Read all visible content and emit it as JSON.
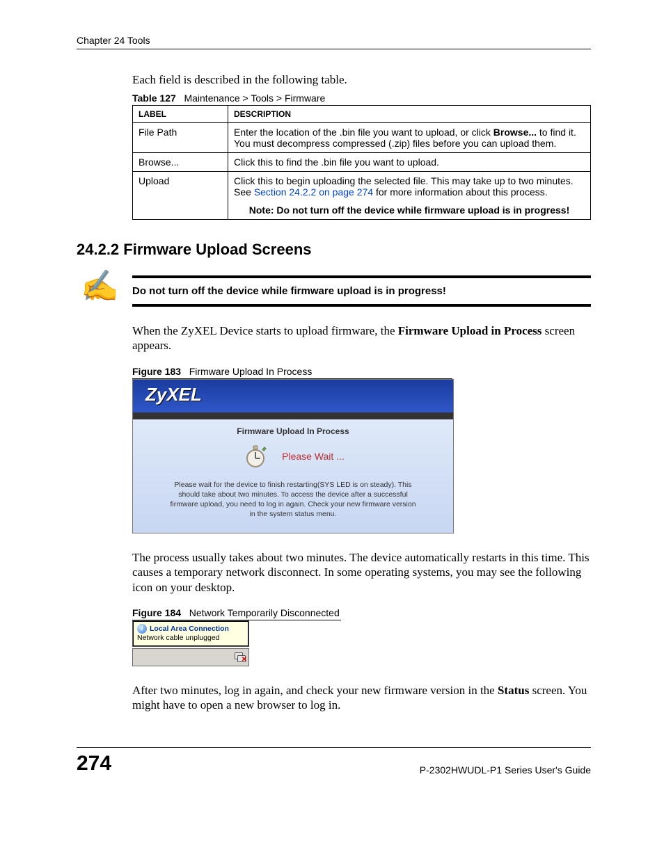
{
  "header": {
    "chapter": "Chapter 24 Tools"
  },
  "intro": "Each field is described in the following table.",
  "table_caption": {
    "label": "Table 127",
    "text": "Maintenance > Tools > Firmware"
  },
  "table": {
    "headers": {
      "label": "LABEL",
      "description": "DESCRIPTION"
    },
    "rows": [
      {
        "label": "File Path",
        "desc_pre": "Enter the location of the .bin file you want to upload, or click ",
        "desc_bold": "Browse...",
        "desc_post": " to find it. You must decompress compressed (.zip) files before you can upload them."
      },
      {
        "label": "Browse...",
        "desc": "Click this to find the .bin file you want to upload."
      },
      {
        "label": "Upload",
        "desc_pre": "Click this to begin uploading the selected file. This may take up to two minutes. See ",
        "desc_link": "Section 24.2.2 on page 274",
        "desc_post": " for more information about this process.",
        "note": "Note: Do not turn off the device while firmware upload is in progress!"
      }
    ]
  },
  "section_heading": "24.2.2  Firmware Upload Screens",
  "callout": "Do not turn off the device while firmware upload is in progress!",
  "para1_pre": "When the ZyXEL Device starts to upload firmware, the ",
  "para1_bold": "Firmware Upload in Process",
  "para1_post": " screen appears.",
  "fig183": {
    "label": "Figure 183",
    "text": "Firmware Upload In Process"
  },
  "zyxel": {
    "logo": "ZyXEL",
    "title": "Firmware Upload In Process",
    "wait": "Please Wait ...",
    "msg": "Please wait for the device to finish restarting(SYS LED is on steady). This should take about two minutes. To access the device after a successful firmware upload, you need to log in again. Check your new firmware version in the system status menu."
  },
  "para2": "The process usually takes about two minutes. The device automatically restarts in this time. This causes a temporary network disconnect. In some operating systems, you may see the following icon on your desktop.",
  "fig184": {
    "label": "Figure 184",
    "text": "Network Temporarily Disconnected"
  },
  "net": {
    "title": "Local Area Connection",
    "msg": "Network cable unplugged"
  },
  "para3_pre": "After two minutes, log in again, and check your new firmware version in the ",
  "para3_bold": "Status",
  "para3_post": " screen. You might have to open a new browser to log in.",
  "footer": {
    "page": "274",
    "guide": "P-2302HWUDL-P1 Series User's Guide"
  }
}
